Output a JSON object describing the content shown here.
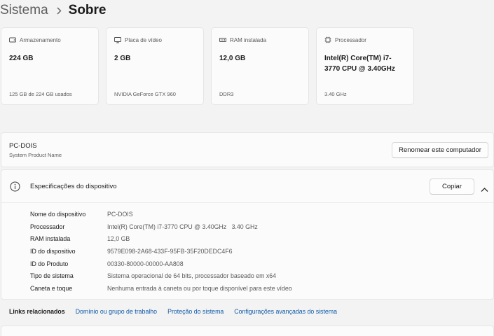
{
  "breadcrumb": {
    "parent": "Sistema",
    "current": "Sobre"
  },
  "cards": [
    {
      "icon": "storage-icon",
      "label": "Armazenamento",
      "value": "224 GB",
      "sub": "125 GB de 224 GB usados"
    },
    {
      "icon": "graphics-card-icon",
      "label": "Placa de vídeo",
      "value": "2 GB",
      "sub": "NVIDIA GeForce GTX 960"
    },
    {
      "icon": "ram-icon",
      "label": "RAM instalada",
      "value": "12,0 GB",
      "sub": "DDR3"
    },
    {
      "icon": "processor-icon",
      "label": "Processador",
      "value": "Intel(R) Core(TM) i7-3770 CPU @ 3.40GHz",
      "sub": "3.40 GHz"
    }
  ],
  "pc": {
    "name": "PC-DOIS",
    "subtitle": "System Product Name",
    "rename_label": "Renomear este computador"
  },
  "specs": {
    "title": "Especificações do dispositivo",
    "copy_label": "Copiar",
    "rows": [
      {
        "key": "Nome do dispositivo",
        "value": "PC-DOIS"
      },
      {
        "key": "Processador",
        "value": "Intel(R) Core(TM) i7-3770 CPU @ 3.40GHz   3.40 GHz"
      },
      {
        "key": "RAM instalada",
        "value": "12,0 GB"
      },
      {
        "key": "ID do dispositivo",
        "value": "9579E098-2A68-433F-95FB-35F20DEDC4F6"
      },
      {
        "key": "ID do Produto",
        "value": "00330-80000-00000-AA808"
      },
      {
        "key": "Tipo de sistema",
        "value": "Sistema operacional de 64 bits, processador baseado em x64"
      },
      {
        "key": "Caneta e toque",
        "value": "Nenhuma entrada à caneta ou por toque disponível para este vídeo"
      }
    ]
  },
  "related_links": {
    "title": "Links relacionados",
    "links": [
      "Domínio ou grupo de trabalho",
      "Proteção do sistema",
      "Configurações avançadas do sistema"
    ]
  },
  "colors": {
    "accent_link": "#0f5aa8",
    "background": "#f3f3f3",
    "card": "#fbfbfb"
  }
}
